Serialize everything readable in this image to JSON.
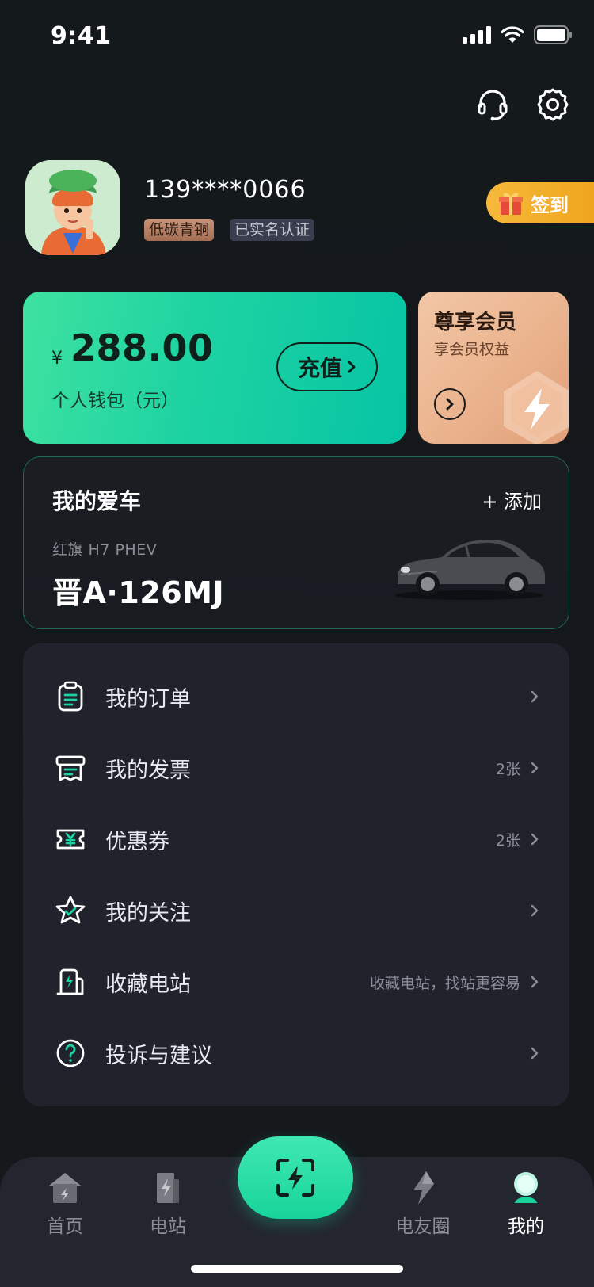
{
  "status_bar": {
    "time": "9:41"
  },
  "profile": {
    "phone": "139****0066",
    "badge_tier": "低碳青铜",
    "badge_verify": "已实名认证",
    "checkin_label": "签到"
  },
  "wallet": {
    "currency": "¥",
    "amount": "288.00",
    "label": "个人钱包（元）",
    "recharge_label": "充值"
  },
  "vip": {
    "title": "尊享会员",
    "subtitle": "享会员权益"
  },
  "car": {
    "title": "我的爱车",
    "add_label": "+ 添加",
    "model": "红旗  H7 PHEV",
    "plate": "晋A·126MJ"
  },
  "menu": {
    "items": [
      {
        "label": "我的订单",
        "hint": "",
        "icon": "clipboard-icon"
      },
      {
        "label": "我的发票",
        "hint": "2张",
        "icon": "invoice-icon"
      },
      {
        "label": "优惠券",
        "hint": "2张",
        "icon": "coupon-icon"
      },
      {
        "label": "我的关注",
        "hint": "",
        "icon": "star-icon"
      },
      {
        "label": "收藏电站",
        "hint": "收藏电站，找站更容易",
        "icon": "charging-station-icon"
      },
      {
        "label": "投诉与建议",
        "hint": "",
        "icon": "help-icon"
      }
    ]
  },
  "tabbar": {
    "tabs": [
      {
        "label": "首页",
        "icon": "home-icon"
      },
      {
        "label": "电站",
        "icon": "station-icon"
      },
      {
        "label": "电友圈",
        "icon": "community-icon"
      },
      {
        "label": "我的",
        "icon": "profile-icon",
        "active": true
      }
    ],
    "scan_icon": "scan-charge-icon"
  },
  "colors": {
    "accent": "#1dd3a2",
    "background": "#14171b",
    "card": "#20222c",
    "checkin": "#f2ad2b",
    "vip": "#eab38d"
  }
}
